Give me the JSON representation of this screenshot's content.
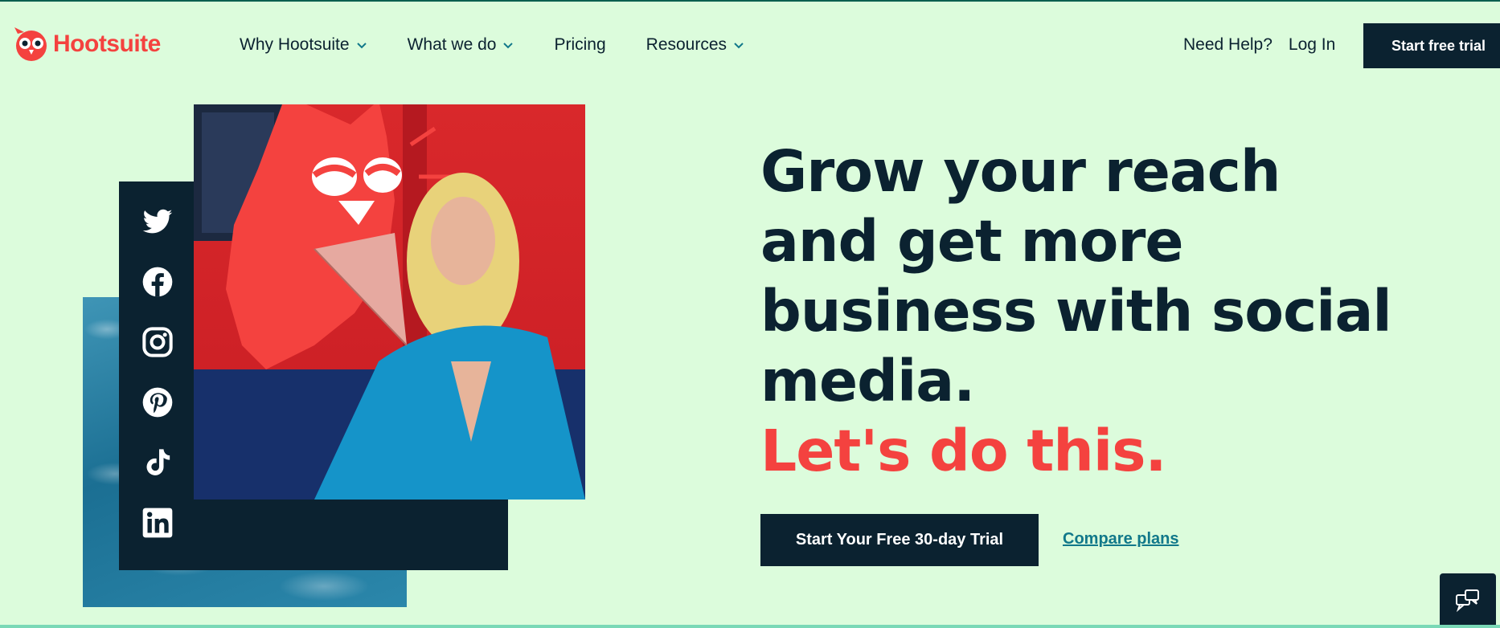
{
  "brand": {
    "name": "Hootsuite",
    "accent": "#f4423f",
    "dark": "#0b2230",
    "bg": "#dcfcdc"
  },
  "nav": {
    "items": [
      {
        "label": "Why Hootsuite",
        "dropdown": true
      },
      {
        "label": "What we do",
        "dropdown": true
      },
      {
        "label": "Pricing",
        "dropdown": false
      },
      {
        "label": "Resources",
        "dropdown": true
      }
    ],
    "help": "Need Help?",
    "login": "Log In",
    "trial": "Start free trial"
  },
  "hero": {
    "headline_lines": [
      "Grow your reach",
      "and get more",
      "business with social",
      "media."
    ],
    "tagline": "Let's do this.",
    "cta": "Start Your Free 30-day Trial",
    "compare": "Compare plans"
  },
  "social_icons": [
    "twitter-icon",
    "facebook-icon",
    "instagram-icon",
    "pinterest-icon",
    "tiktok-icon",
    "linkedin-icon"
  ]
}
